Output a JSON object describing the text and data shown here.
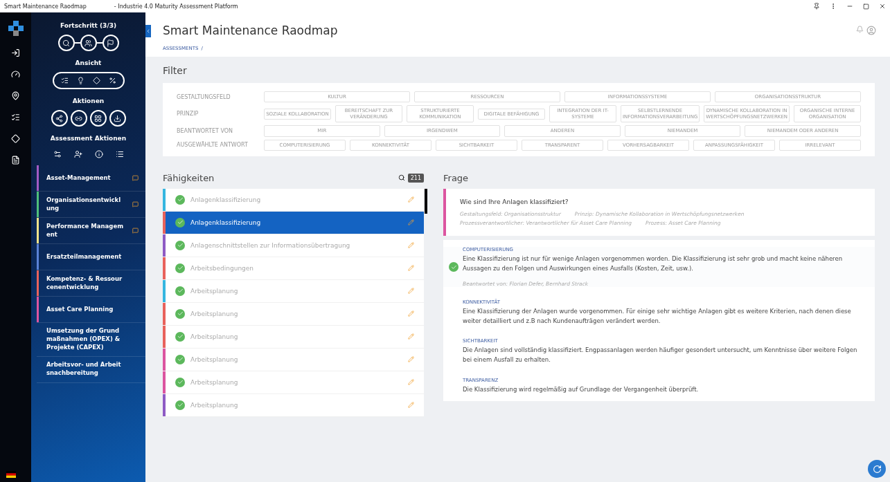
{
  "window": {
    "title": "Smart Maintenance Raodmap",
    "subtitle": "- Industrie 4.0 Maturity Assessment Platform"
  },
  "sidebar": {
    "progress_label": "Fortschritt (3/3)",
    "view_label": "Ansicht",
    "actions_label": "Aktionen",
    "assessment_actions_label": "Assessment Aktionen",
    "items": [
      {
        "label": "Asset-Management",
        "color": "#a25bc4",
        "comment": true
      },
      {
        "label": "Organisationsentwicklung",
        "color": "#4fbf7a",
        "comment": true
      },
      {
        "label": "Performance Management",
        "color": "#f2e38a",
        "comment": true
      },
      {
        "label": "Ersatzteilmanagement",
        "color": "#5a82d6",
        "comment": false
      },
      {
        "label": "Kompetenz- & Ressourcenentwicklung",
        "color": "#e8625c",
        "comment": false
      },
      {
        "label": "Asset Care Planning",
        "color": "#dc55a0",
        "comment": false
      },
      {
        "label": "Umsetzung der Grundmaßnahmen (OPEX) & Projekte (CAPEX)",
        "comment": false
      },
      {
        "label": "Arbeitsvor- und Arbeitsnachbereitung",
        "comment": false
      }
    ]
  },
  "header": {
    "title": "Smart Maintenance Raodmap",
    "breadcrumb": "ASSESSMENTS",
    "separator": "/"
  },
  "filter": {
    "title": "Filter",
    "rows": [
      {
        "label": "GESTALTUNGSFELD",
        "chips": [
          "KULTUR",
          "RESSOURCEN",
          "INFORMATIONSSYSTEME",
          "ORGANISATIONSSTRUKTUR"
        ]
      },
      {
        "label": "PRINZIP",
        "chips": [
          "SOZIALE KOLLABORATION",
          "BEREITSCHAFT ZUR VERÄNDERUNG",
          "STRUKTURIERTE KOMMUNIKATION",
          "DIGITALE BEFÄHIGUNG",
          "INTEGRATION DER IT-SYSTEME",
          "SELBSTLERNENDE INFORMATIONSVERARBEITUNG",
          "DYNAMISCHE KOLLABORATION IN WERTSCHÖPFUNGSNETZWERKEN",
          "ORGANISCHE INTERNE ORGANISATION"
        ]
      },
      {
        "label": "BEANTWORTET VON",
        "chips": [
          "MIR",
          "IRGENDWEM",
          "ANDEREN",
          "NIEMANDEM",
          "NIEMANDEM ODER ANDEREN"
        ]
      },
      {
        "label": "AUSGEWÄHLTE ANTWORT",
        "chips": [
          "COMPUTERISIERUNG",
          "KONNEKTIVITÄT",
          "SICHTBARKEIT",
          "TRANSPARENT",
          "VORHERSAGBARKEIT",
          "ANPASSUNGSFÄHIGKEIT",
          "IRRELEVANT"
        ]
      }
    ]
  },
  "skills": {
    "title": "Fähigkeiten",
    "count": "211",
    "items": [
      {
        "label": "Anlagenklassifizierung",
        "color": "#35b6e0",
        "selected": false
      },
      {
        "label": "Anlagenklassifizierung",
        "color": "#e8625c",
        "selected": true
      },
      {
        "label": "Anlagenschnittstellen zur Informationsübertragung",
        "color": "#8e5bc4",
        "selected": false
      },
      {
        "label": "Arbeitsbedingungen",
        "color": "#e8625c",
        "selected": false
      },
      {
        "label": "Arbeitsplanung",
        "color": "#35b6e0",
        "selected": false
      },
      {
        "label": "Arbeitsplanung",
        "color": "#e8625c",
        "selected": false
      },
      {
        "label": "Arbeitsplanung",
        "color": "#e8625c",
        "selected": false
      },
      {
        "label": "Arbeitsplanung",
        "color": "#dc55a0",
        "selected": false
      },
      {
        "label": "Arbeitsplanung",
        "color": "#dc55a0",
        "selected": false
      },
      {
        "label": "Arbeitsplanung",
        "color": "#8e5bc4",
        "selected": false
      }
    ]
  },
  "question": {
    "title": "Frage",
    "text": "Wie sind Ihre Anlagen klassifiziert?",
    "meta": [
      "Gestaltungsfeld: Organisationsstruktur",
      "Prinzip: Dynamische Kollaboration in Wertschöpfungsnetzwerken",
      "Prozessverantwortlicher: Verantwortlicher für Asset Care Planning",
      "Prozess: Asset Care Planning"
    ],
    "answers": [
      {
        "level": "COMPUTERISIERUNG",
        "text": "Eine Klassifizierung ist nur für wenige Anlagen vorgenommen worden. Die Klassifizierung ist sehr grob und macht keine näheren Aussagen zu den Folgen und Auswirkungen eines Ausfalls (Kosten, Zeit, usw.).",
        "selected": true,
        "answered_by": "Beantwortet von: Florian Defer, Bernhard Strack"
      },
      {
        "level": "KONNEKTIVITÄT",
        "text": "Eine Klassifizierung der Anlagen wurde vorgenommen. Für einige sehr wichtige Anlagen gibt es weitere Kriterien, nach denen diese weiter detailliert und z.B nach Kundenaufträgen verändert werden.",
        "selected": false
      },
      {
        "level": "SICHTBARKEIT",
        "text": "Die Anlagen sind vollständig klassifiziert. Engpassanlagen werden häufiger gesondert untersucht, um Kenntnisse über weitere Folgen bei einem Ausfall zu erhalten.",
        "selected": false
      },
      {
        "level": "TRANSPARENZ",
        "text": "Die Klassifizierung wird regelmäßig auf Grundlage der Vergangenheit überprüft.",
        "selected": false
      }
    ]
  }
}
